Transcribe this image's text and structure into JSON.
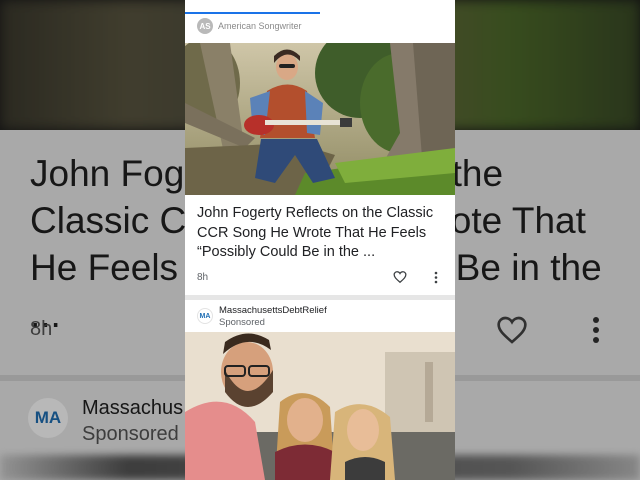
{
  "backdrop": {
    "headline": "John Fogerty Reflects on the Classic CCR Song He Wrote That He Feels “Possibly Could Be in the ...",
    "time": "8h",
    "sponsor_name": "Massachus",
    "sponsor_label": "Sponsored",
    "sponsor_logo_text": "MA"
  },
  "feed": {
    "article": {
      "source_logo_text": "AS",
      "source": "American Songwriter",
      "headline": "John Fogerty Reflects on the Classic CCR Song He Wrote That He Feels “Possibly Could Be in the ...",
      "time": "8h",
      "icons": [
        "heart-icon",
        "more-vert-icon"
      ]
    },
    "ad": {
      "logo_text": "MA",
      "publisher": "MassachusettsDebtRelief",
      "label": "Sponsored"
    }
  },
  "colors": {
    "accent": "#1a73e8",
    "text_primary": "#202124",
    "text_secondary": "#5f6368"
  }
}
